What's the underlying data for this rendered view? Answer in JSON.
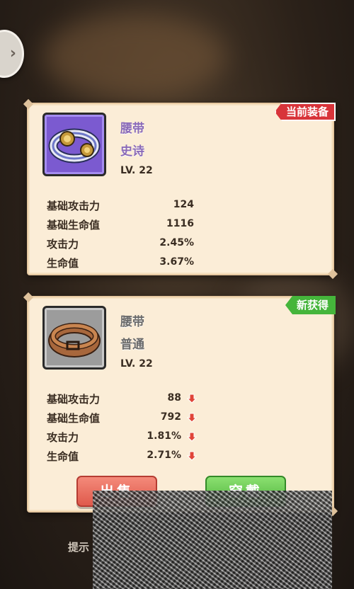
{
  "current_item": {
    "badge": "当前装备",
    "name": "腰带",
    "rarity": "史诗",
    "level": "LV. 22",
    "icon": "epic-belt-icon",
    "stats": [
      {
        "label": "基础攻击力",
        "value": "124"
      },
      {
        "label": "基础生命值",
        "value": "1116"
      },
      {
        "label": "攻击力",
        "value": "2.45%"
      },
      {
        "label": "生命值",
        "value": "3.67%"
      }
    ]
  },
  "new_item": {
    "badge": "新获得",
    "name": "腰带",
    "rarity": "普通",
    "level": "LV. 22",
    "icon": "common-belt-icon",
    "stats": [
      {
        "label": "基础攻击力",
        "value": "88",
        "trend": "down"
      },
      {
        "label": "基础生命值",
        "value": "792",
        "trend": "down"
      },
      {
        "label": "攻击力",
        "value": "1.81%",
        "trend": "down"
      },
      {
        "label": "生命值",
        "value": "2.71%",
        "trend": "down"
      }
    ],
    "sell_label": "出售",
    "equip_label": "穿戴"
  },
  "hint": "提示",
  "colors": {
    "epic": "#7b5ad0",
    "common": "#9c9c9c",
    "current_badge": "#d8343a",
    "new_badge": "#45b53b",
    "sell": "#e2655a",
    "equip": "#5bbd45",
    "down_arrow": "#e04438"
  }
}
